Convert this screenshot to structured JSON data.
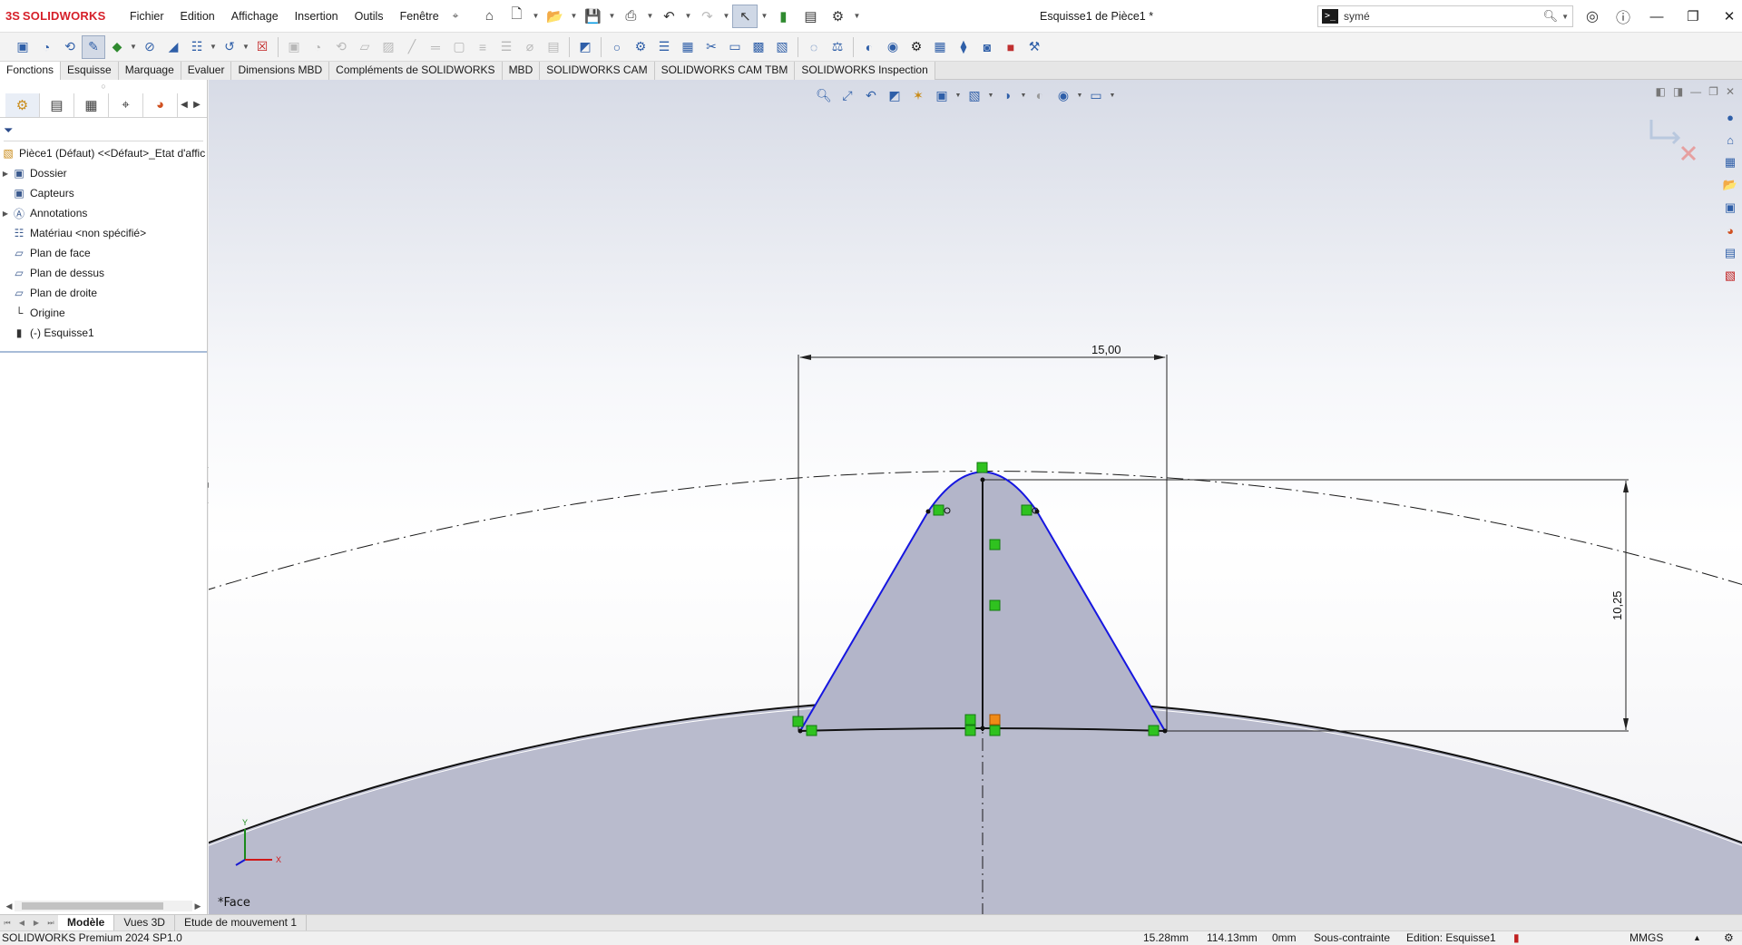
{
  "app": {
    "brand_prefix": "3S",
    "brand": "SOLIDWORKS",
    "document_title": "Esquisse1 de Pièce1 *"
  },
  "menu": [
    "Fichier",
    "Edition",
    "Affichage",
    "Insertion",
    "Outils",
    "Fenêtre"
  ],
  "search": {
    "value": "symé",
    "prompt_glyph": ">_"
  },
  "tabs": [
    "Fonctions",
    "Esquisse",
    "Marquage",
    "Evaluer",
    "Dimensions MBD",
    "Compléments de SOLIDWORKS",
    "MBD",
    "SOLIDWORKS CAM",
    "SOLIDWORKS CAM TBM",
    "SOLIDWORKS Inspection"
  ],
  "active_tab": "Fonctions",
  "tree": {
    "root": "Pièce1 (Défaut) <<Défaut>_Etat d'affic",
    "items": [
      {
        "label": "Dossier",
        "expandable": true,
        "icon": "folder-icon"
      },
      {
        "label": "Capteurs",
        "expandable": false,
        "icon": "sensor-icon"
      },
      {
        "label": "Annotations",
        "expandable": true,
        "icon": "annotations-icon"
      },
      {
        "label": "Matériau <non spécifié>",
        "expandable": false,
        "icon": "material-icon"
      },
      {
        "label": "Plan de face",
        "expandable": false,
        "icon": "plane-icon"
      },
      {
        "label": "Plan de dessus",
        "expandable": false,
        "icon": "plane-icon"
      },
      {
        "label": "Plan de droite",
        "expandable": false,
        "icon": "plane-icon"
      },
      {
        "label": "Origine",
        "expandable": false,
        "icon": "origin-icon"
      },
      {
        "label": "(-) Esquisse1",
        "expandable": false,
        "icon": "sketch-icon"
      }
    ]
  },
  "sketch": {
    "dimension_width": "15,00",
    "dimension_height": "10,25",
    "view_label": "*Face",
    "triad": {
      "x": "X",
      "y": "Y"
    },
    "colors": {
      "profile": "#1616e0",
      "relation": "#2fc21f",
      "fill": "#b3b5c9",
      "body": "#b9bbcd"
    }
  },
  "bottom_tabs": [
    "Modèle",
    "Vues 3D",
    "Etude de mouvement 1"
  ],
  "status": {
    "product": "SOLIDWORKS Premium 2024 SP1.0",
    "x": "15.28mm",
    "y": "114.13mm",
    "z": "0mm",
    "state": "Sous-contrainte",
    "editing": "Edition: Esquisse1",
    "units": "MMGS"
  }
}
